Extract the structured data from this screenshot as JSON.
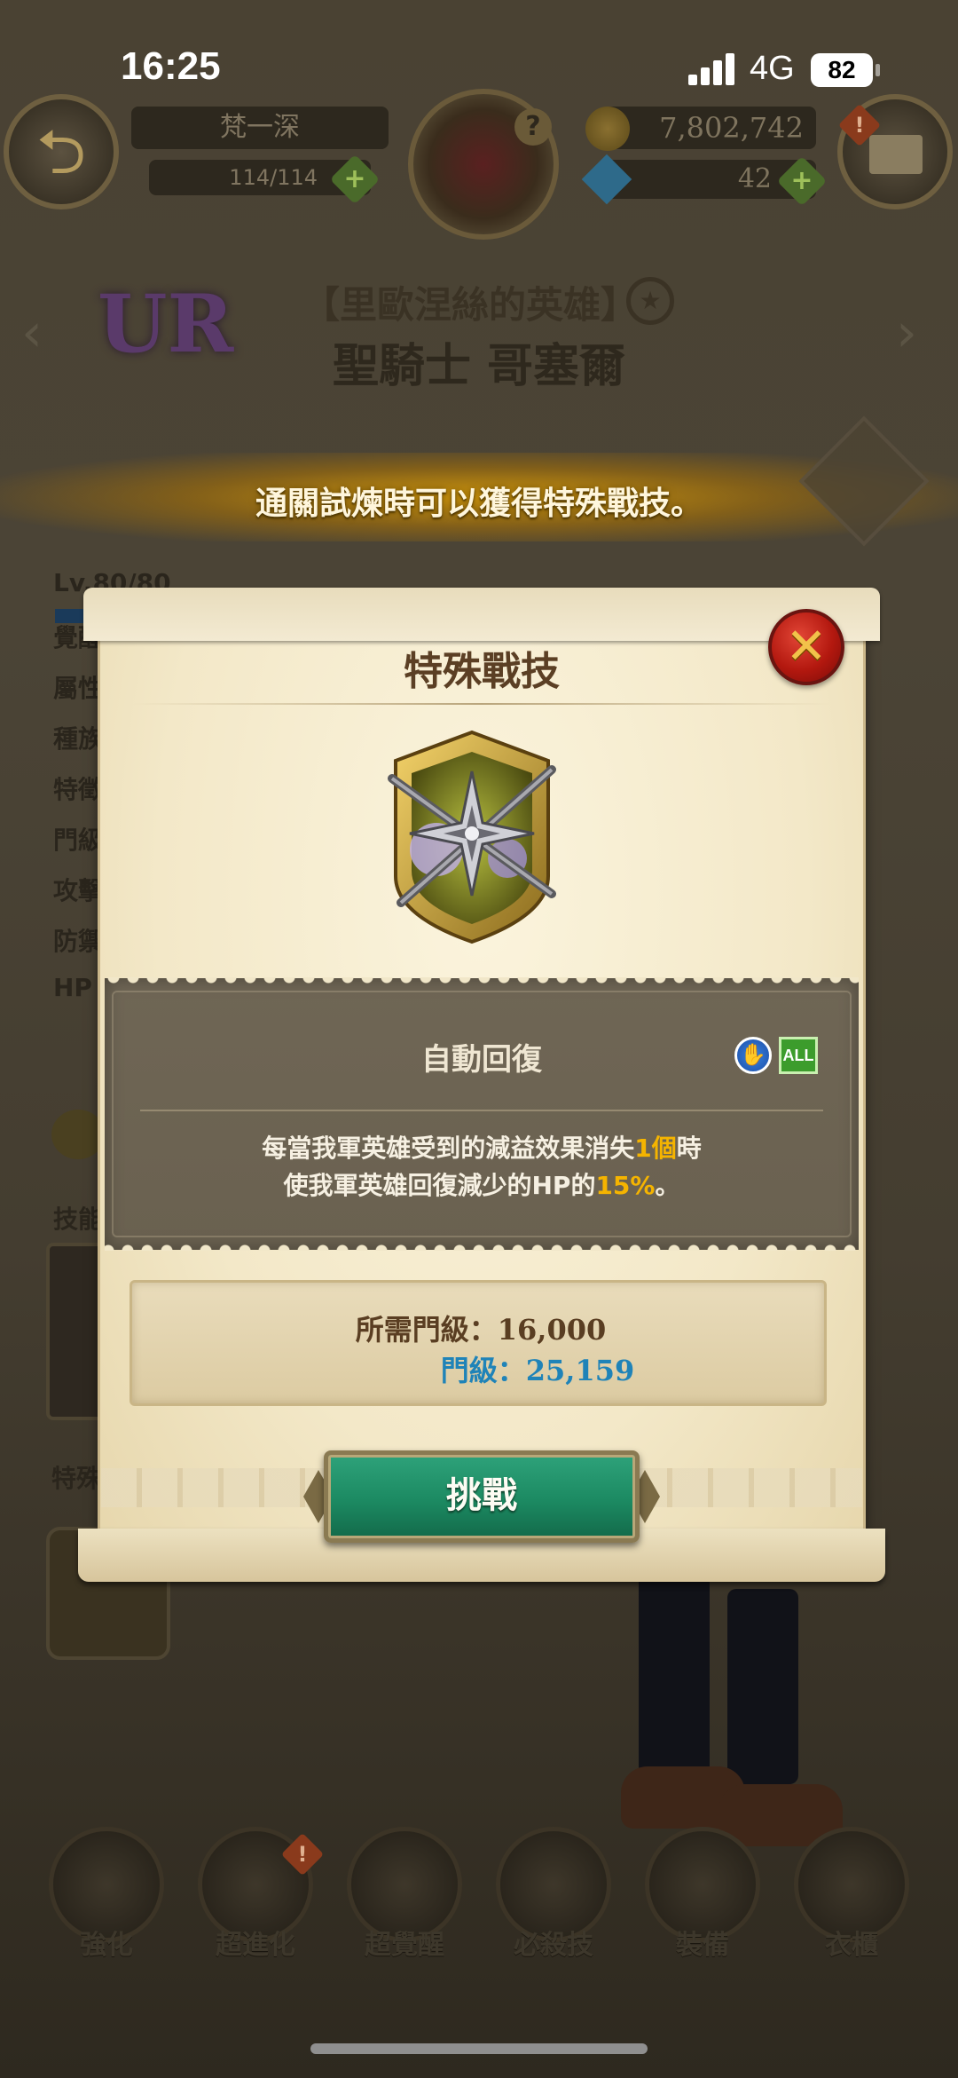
{
  "status_bar": {
    "time": "16:25",
    "network": "4G",
    "battery": "82"
  },
  "top_bar": {
    "player_name": "梵一深",
    "stamina": "114/114",
    "gold": "7,802,742",
    "gems": "42"
  },
  "hero": {
    "rarity": "UR",
    "title": "【里歐涅絲的英雄】",
    "name": "聖騎士 哥塞爾"
  },
  "banner_text": "通關試煉時可以獲得特殊戰技。",
  "left_stats": {
    "level": "Lv.80/80",
    "rows": [
      "覺醒",
      "屬性",
      "種族",
      "特徵",
      "門級",
      "攻擊",
      "防禦",
      "HP"
    ],
    "skills_label": "技能",
    "special_label": "特殊"
  },
  "modal": {
    "title": "特殊戰技",
    "effect_name": "自動回復",
    "target_badge": "ALL",
    "description": {
      "line1_prefix": "每當我軍英雄受到的減益效果消失",
      "line1_highlight": "1個",
      "line1_suffix": "時",
      "line2_prefix": "使我軍英雄回復減少的HP的",
      "line2_highlight": "15%",
      "line2_suffix": "。"
    },
    "required_rank_label": "所需門級：",
    "required_rank_value": "16,000",
    "current_rank_label": "門級：",
    "current_rank_value": "25,159",
    "challenge_button": "挑戰"
  },
  "bottom_menu": [
    {
      "label": "強化",
      "icon": "armor-upgrade-icon"
    },
    {
      "label": "超進化",
      "icon": "evolution-icon"
    },
    {
      "label": "超覺醒",
      "icon": "awakening-icon"
    },
    {
      "label": "必殺技",
      "icon": "ultimate-icon"
    },
    {
      "label": "裝備",
      "icon": "equipment-icon"
    },
    {
      "label": "衣櫃",
      "icon": "wardrobe-icon"
    }
  ],
  "colors": {
    "banner_gold": "#d79b0a",
    "highlight_orange": "#f5b400",
    "rank_blue": "#1f83b8",
    "challenge_green": "#1c8a62",
    "close_red": "#b3180f"
  }
}
